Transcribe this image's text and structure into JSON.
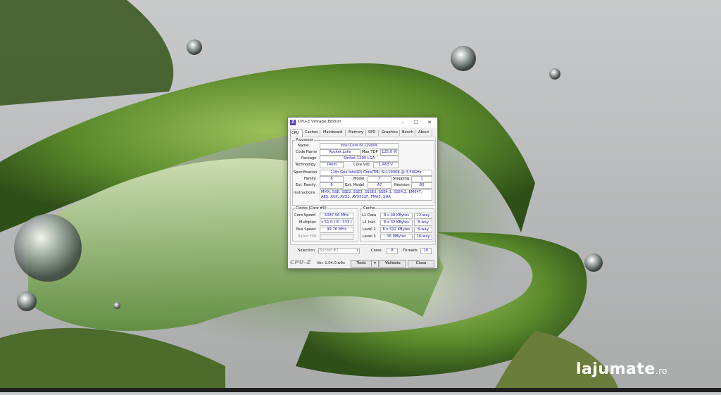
{
  "window": {
    "title": "CPU-Z Vintage Edition",
    "logo": "Z",
    "minimize": "–",
    "maximize": "☐",
    "close": "✕"
  },
  "tabs": [
    "CPU",
    "Caches",
    "Mainboard",
    "Memory",
    "SPD",
    "Graphics",
    "Bench",
    "About"
  ],
  "processor": {
    "group_title": "Processor",
    "name_label": "Name",
    "name": "Intel Core i9 11900K",
    "codename_label": "Code Name",
    "codename": "Rocket Lake",
    "maxtdp_label": "Max TDP",
    "maxtdp": "125.0 W",
    "package_label": "Package",
    "package": "Socket 1200 LGA",
    "technology_label": "Technology",
    "technology": "14nm",
    "corevid_label": "Core VID",
    "corevid": "1.463 V",
    "spec_label": "Specification",
    "spec": "11th Gen Intel(R) Core(TM) i9-11900K @ 3.50GHz",
    "family_label": "Family",
    "family": "6",
    "model_label": "Model",
    "model": "7",
    "stepping_label": "Stepping",
    "stepping": "1",
    "extfamily_label": "Ext. Family",
    "extfamily": "6",
    "extmodel_label": "Ext. Model",
    "extmodel": "A7",
    "revision_label": "Revision",
    "revision": "B0",
    "instructions_label": "Instructions",
    "instructions": "MMX, SSE, SSE2, SSE3, SSSE3, SSE4.1, SSE4.2, EM64T, AES, AVX, AVX2, AVX512F, FMA3, SHA"
  },
  "clocks": {
    "group_title": "Clocks (Core #0)",
    "corespeed_label": "Core Speed",
    "corespeed": "5087.56 MHz",
    "multiplier_label": "Multiplier",
    "multiplier": "x 51.0 ( 8 - 133 )",
    "busspeed_label": "Bus Speed",
    "busspeed": "99.76 MHz",
    "ratedfsb_label": "Rated FSB",
    "ratedfsb": ""
  },
  "cache": {
    "group_title": "Cache",
    "rows": [
      {
        "label": "L1 Data",
        "size": "8 x 48 KBytes",
        "way": "12-way"
      },
      {
        "label": "L1 Inst.",
        "size": "8 x 32 KBytes",
        "way": "8-way"
      },
      {
        "label": "Level 2",
        "size": "8 x 512 KBytes",
        "way": "8-way"
      },
      {
        "label": "Level 3",
        "size": "16 MBytes",
        "way": "16-way"
      }
    ]
  },
  "selection": {
    "label": "Selection",
    "value": "Socket #1",
    "cores_label": "Cores",
    "cores": "8",
    "threads_label": "Threads",
    "threads": "16"
  },
  "footer": {
    "brand": "CPU-Z",
    "version": "Ver. 1.04.0.w9x",
    "tools": "Tools",
    "validate": "Validate",
    "close": "Close"
  },
  "watermark": {
    "main": "lajumate",
    "tld": ".ro"
  },
  "colors": {
    "value_text": "#1c1cc0",
    "logo_bg": "#5b3fb5"
  }
}
